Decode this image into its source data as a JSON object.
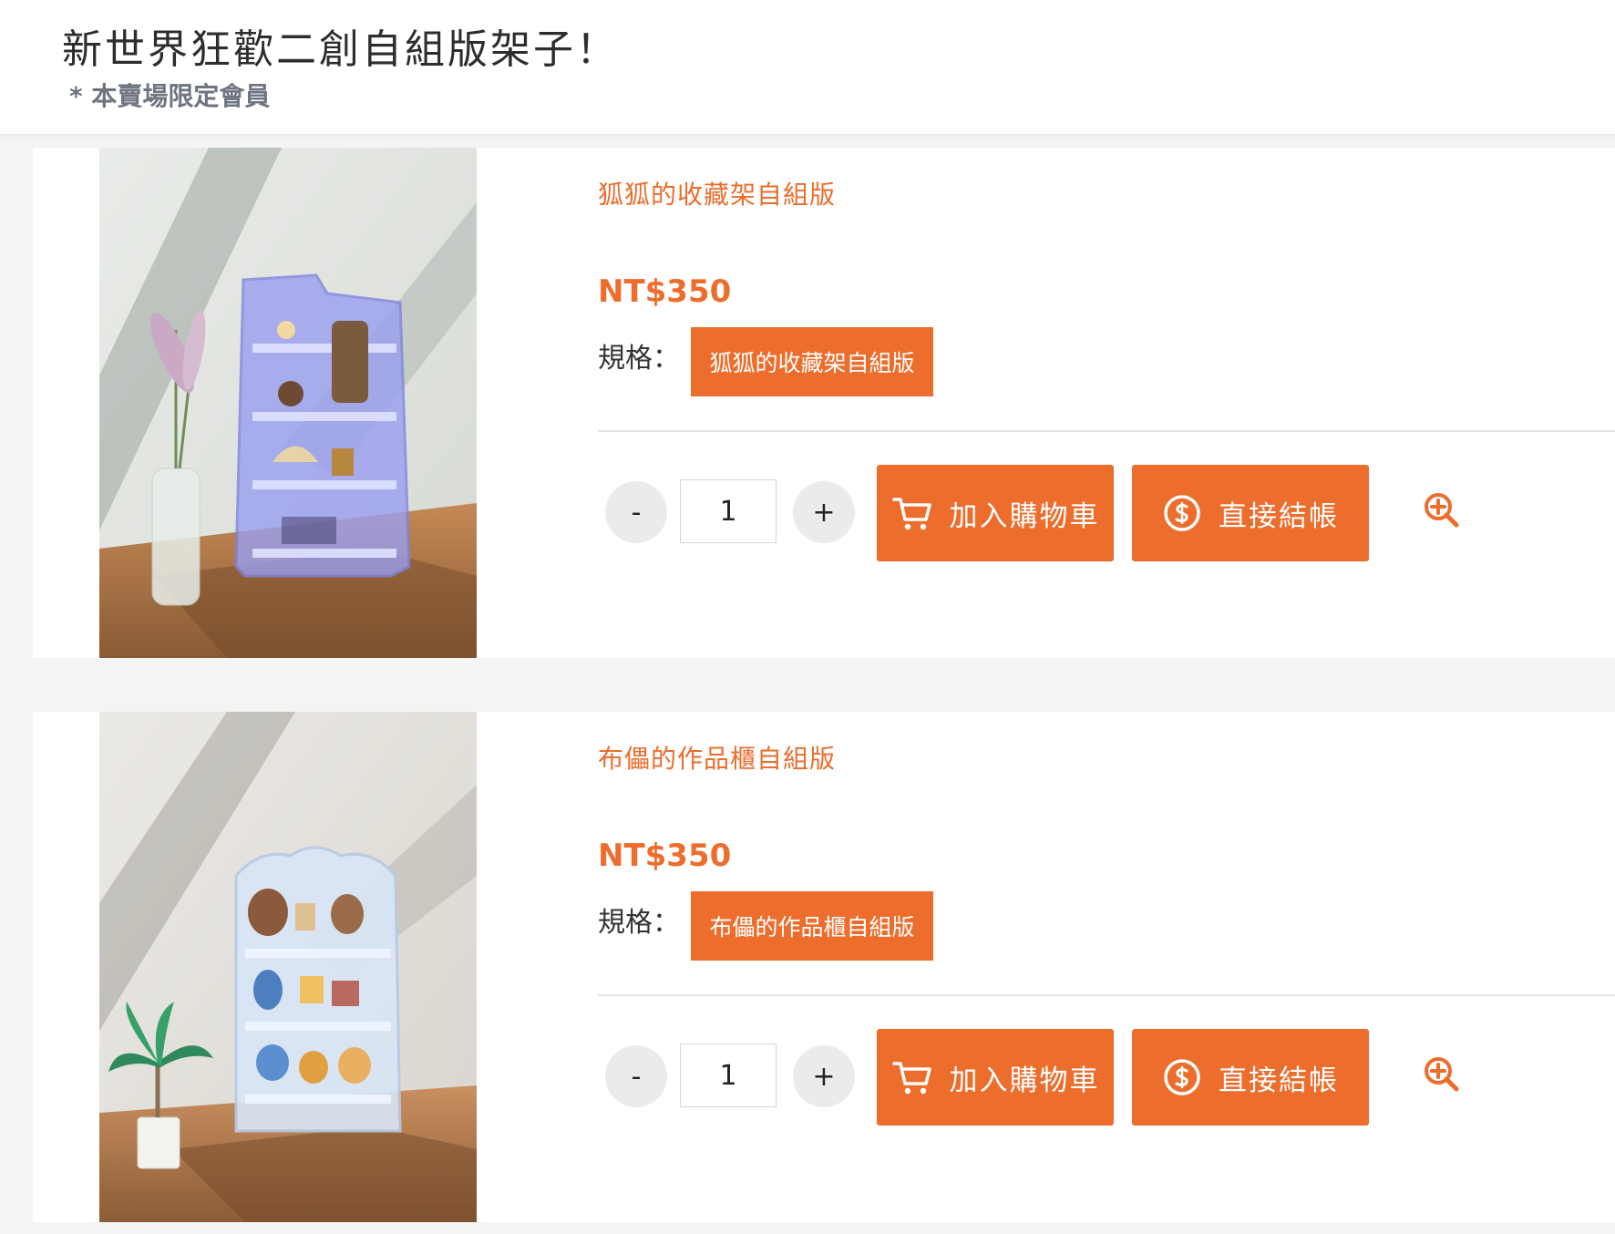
{
  "header": {
    "title": "新世界狂歡二創自組版架子！",
    "subtitle": "* 本賣場限定會員"
  },
  "colors": {
    "accent": "#ec6d2c",
    "subtitle": "#6e7480",
    "card_bg": "#ffffff",
    "page_bg": "#f4f4f5"
  },
  "icons": [
    "cart-icon",
    "dollar-icon",
    "zoom-in-icon"
  ],
  "products": [
    {
      "name": "狐狐的收藏架自組版",
      "price": "NT$350",
      "spec_label": "規格：",
      "spec_option": "狐狐的收藏架自組版",
      "quantity": "1",
      "minus": "-",
      "plus": "+",
      "add_to_cart": "加入購物車",
      "checkout": "直接結帳"
    },
    {
      "name": "布儡的作品櫃自組版",
      "price": "NT$350",
      "spec_label": "規格：",
      "spec_option": "布儡的作品櫃自組版",
      "quantity": "1",
      "minus": "-",
      "plus": "+",
      "add_to_cart": "加入購物車",
      "checkout": "直接結帳"
    }
  ]
}
